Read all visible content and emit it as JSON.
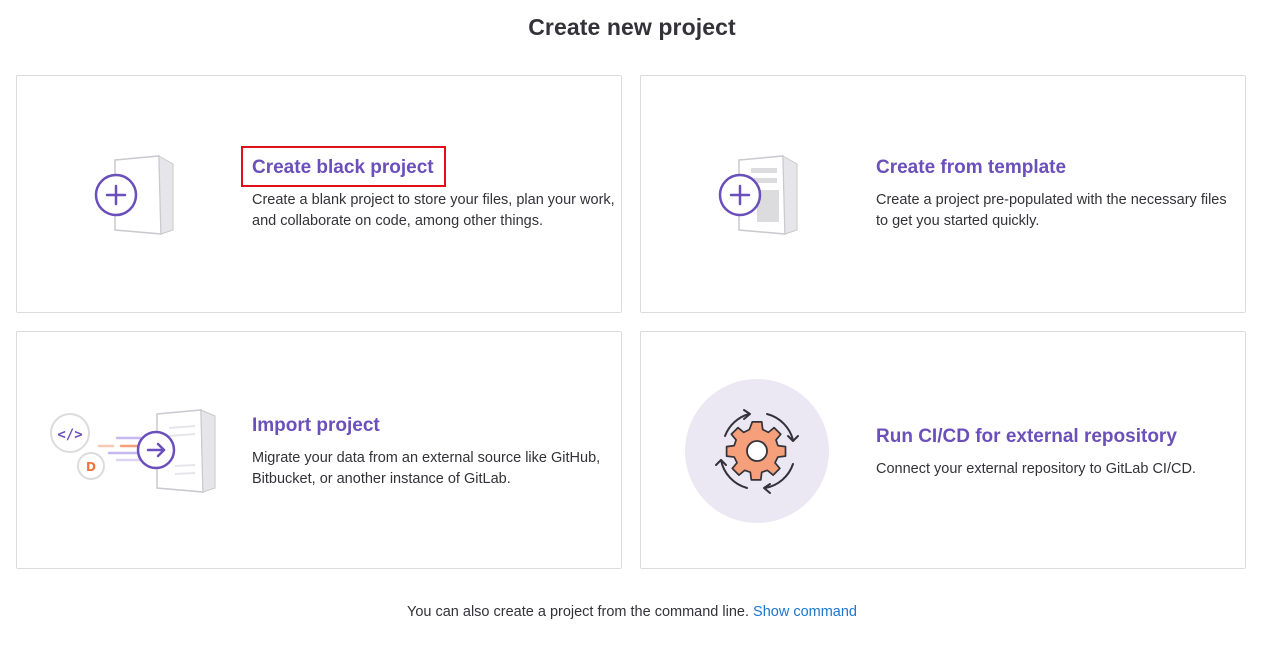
{
  "page": {
    "title": "Create new project"
  },
  "cards": [
    {
      "title": "Create black project",
      "description": "Create a blank project to store your files, plan your work, and collaborate on code, among other things.",
      "icon": "blank-project-illustration"
    },
    {
      "title": "Create from template",
      "description": "Create a project pre-populated with the necessary files to get you started quickly.",
      "icon": "template-project-illustration"
    },
    {
      "title": "Import project",
      "description": "Migrate your data from an external source like GitHub, Bitbucket, or another instance of GitLab.",
      "icon": "import-project-illustration"
    },
    {
      "title": "Run CI/CD for external repository",
      "description": "Connect your external repository to GitLab CI/CD.",
      "icon": "cicd-gear-illustration"
    }
  ],
  "footer": {
    "text": "You can also create a project from the command line.",
    "link_label": "Show command"
  },
  "colors": {
    "accent": "#6b4fbb",
    "link": "#1f75cb",
    "highlight": "#e0101a",
    "gear": "#f5a07a"
  }
}
